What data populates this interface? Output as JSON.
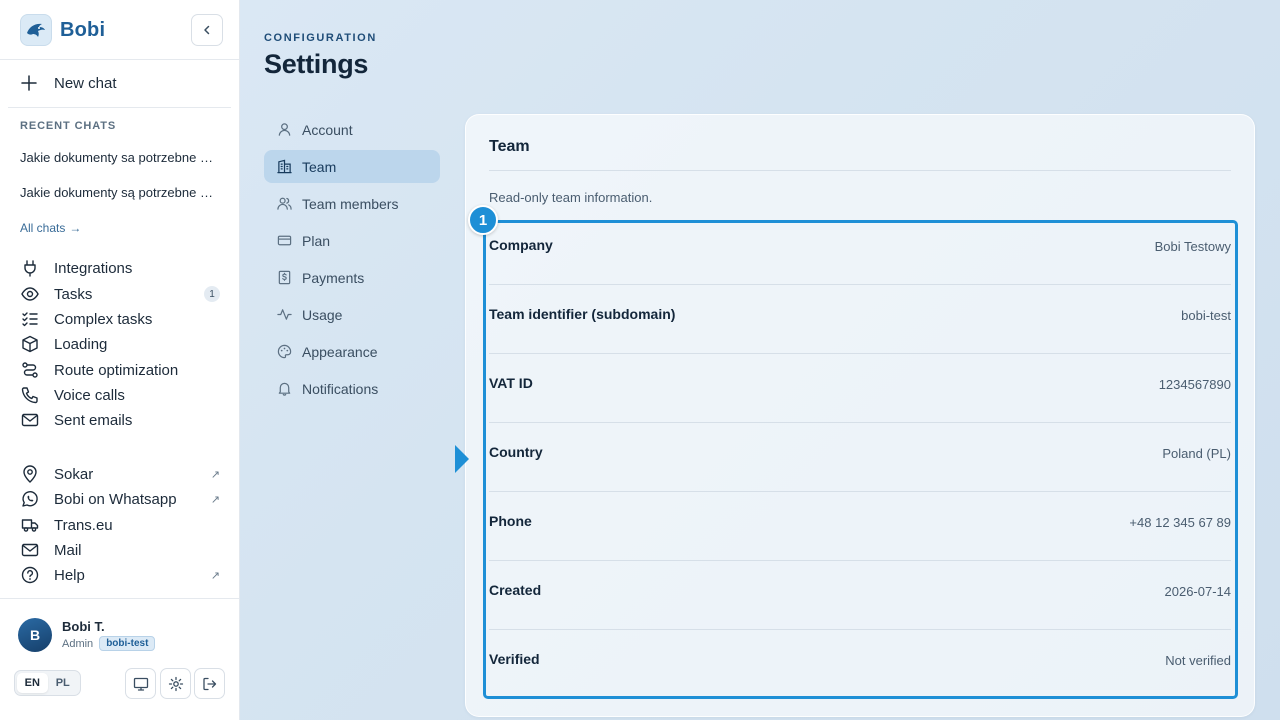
{
  "brand": {
    "name": "Bobi"
  },
  "sidebar": {
    "new_chat": "New chat",
    "recent_title": "RECENT CHATS",
    "recent": [
      "Jakie dokumenty sa potrzebne do...",
      "Jakie dokumenty są potrzebne do..."
    ],
    "all_chats": "All chats",
    "nav": [
      {
        "label": "Integrations",
        "icon": "plug-icon"
      },
      {
        "label": "Tasks",
        "icon": "eye-icon",
        "badge": "1"
      },
      {
        "label": "Complex tasks",
        "icon": "checklist-icon"
      },
      {
        "label": "Loading",
        "icon": "package-icon"
      },
      {
        "label": "Route optimization",
        "icon": "route-icon"
      },
      {
        "label": "Voice calls",
        "icon": "phone-icon"
      },
      {
        "label": "Sent emails",
        "icon": "mail-icon"
      }
    ],
    "links": [
      {
        "label": "Sokar",
        "icon": "location-icon",
        "external": true
      },
      {
        "label": "Bobi on Whatsapp",
        "icon": "whatsapp-icon",
        "external": true
      },
      {
        "label": "Trans.eu",
        "icon": "truck-icon",
        "external": false
      },
      {
        "label": "Mail",
        "icon": "mail-icon",
        "external": false
      },
      {
        "label": "Help",
        "icon": "help-icon",
        "external": true
      }
    ],
    "user": {
      "initial": "B",
      "name": "Bobi T.",
      "role": "Admin",
      "team": "bobi-test"
    },
    "languages": [
      "EN",
      "PL"
    ],
    "active_language": "EN"
  },
  "main": {
    "eyebrow": "CONFIGURATION",
    "title": "Settings",
    "settings_nav": [
      {
        "label": "Account",
        "icon": "user-icon"
      },
      {
        "label": "Team",
        "icon": "building-icon",
        "active": true
      },
      {
        "label": "Team members",
        "icon": "users-icon"
      },
      {
        "label": "Plan",
        "icon": "card-icon"
      },
      {
        "label": "Payments",
        "icon": "dollar-receipt-icon"
      },
      {
        "label": "Usage",
        "icon": "activity-icon"
      },
      {
        "label": "Appearance",
        "icon": "palette-icon"
      },
      {
        "label": "Notifications",
        "icon": "bell-icon"
      }
    ],
    "card": {
      "title": "Team",
      "subtitle": "Read-only team information.",
      "highlight_number": "1",
      "rows": [
        {
          "label": "Company",
          "value": "Bobi Testowy"
        },
        {
          "label": "Team identifier (subdomain)",
          "value": "bobi-test"
        },
        {
          "label": "VAT ID",
          "value": "1234567890"
        },
        {
          "label": "Country",
          "value": "Poland (PL)"
        },
        {
          "label": "Phone",
          "value": "+48 12 345 67 89"
        },
        {
          "label": "Created",
          "value": "2026-07-14"
        },
        {
          "label": "Verified",
          "value": "Not verified"
        }
      ]
    }
  },
  "colors": {
    "accent": "#1e8fd6",
    "brand": "#1f5f97",
    "active_nav_bg": "#bcd6ec"
  }
}
